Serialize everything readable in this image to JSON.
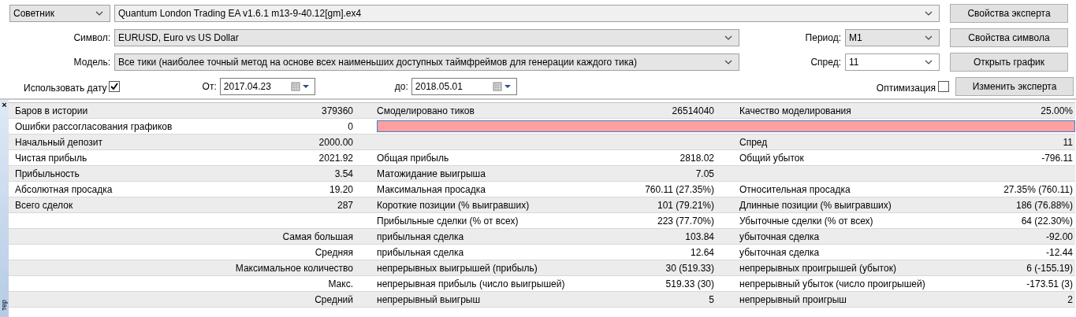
{
  "mode_select": {
    "value": "Советник"
  },
  "expert": {
    "value": "Quantum London Trading EA v1.6.1 m13-9-40.12[gm].ex4"
  },
  "symbol": {
    "label": "Символ:",
    "value": "EURUSD, Euro vs US Dollar"
  },
  "model": {
    "label": "Модель:",
    "value": "Все тики (наиболее точный метод на основе всех наименьших доступных таймфреймов для генерации каждого тика)"
  },
  "period": {
    "label": "Период:",
    "value": "M1"
  },
  "spread": {
    "label": "Спред:",
    "value": "11"
  },
  "use_date": {
    "label": "Использовать дату",
    "checked": true
  },
  "date_from": {
    "label": "От:",
    "value": "2017.04.23"
  },
  "date_to": {
    "label": "до:",
    "value": "2018.05.01"
  },
  "optimization": {
    "label": "Оптимизация",
    "checked": false
  },
  "buttons": [
    "Свойства эксперта",
    "Свойства символа",
    "Открыть график",
    "Изменить эксперта"
  ],
  "side_panel": {
    "close": "×",
    "title": "тер"
  },
  "report": {
    "rows": [
      {
        "kind": "stat",
        "cells": [
          {
            "label": "Баров в истории",
            "value": "379360"
          },
          {
            "label": "Смоделировано тиков",
            "value": "26514040"
          },
          {
            "label": "Качество моделирования",
            "value": "25.00%"
          }
        ]
      },
      {
        "kind": "bar",
        "cells": [
          {
            "label": "Ошибки рассогласования графиков",
            "value": "0"
          }
        ]
      },
      {
        "kind": "stat",
        "cells": [
          {
            "label": "Начальный депозит",
            "value": "2000.00"
          },
          {},
          {
            "label": "Спред",
            "value": "11"
          }
        ]
      },
      {
        "kind": "stat",
        "cells": [
          {
            "label": "Чистая прибыль",
            "value": "2021.92"
          },
          {
            "label": "Общая прибыль",
            "value": "2818.02"
          },
          {
            "label": "Общий убыток",
            "value": "-796.11"
          }
        ]
      },
      {
        "kind": "stat",
        "cells": [
          {
            "label": "Прибыльность",
            "value": "3.54"
          },
          {
            "label": "Матожидание выигрыша",
            "value": "7.05"
          },
          {}
        ]
      },
      {
        "kind": "stat",
        "cells": [
          {
            "label": "Абсолютная просадка",
            "value": "19.20"
          },
          {
            "label": "Максимальная просадка",
            "value": "760.11 (27.35%)"
          },
          {
            "label": "Относительная просадка",
            "value": "27.35% (760.11)"
          }
        ]
      },
      {
        "kind": "stat",
        "cells": [
          {
            "label": "Всего сделок",
            "value": "287"
          },
          {
            "label": "Короткие позиции (% выигравших)",
            "value": "101 (79.21%)"
          },
          {
            "label": "Длинные позиции (% выигравших)",
            "value": "186 (76.88%)"
          }
        ]
      },
      {
        "kind": "stat",
        "cells": [
          {},
          {
            "label": "Прибыльные сделки (% от всех)",
            "value": "223 (77.70%)"
          },
          {
            "label": "Убыточные сделки (% от всех)",
            "value": "64 (22.30%)"
          }
        ]
      },
      {
        "kind": "sub",
        "cells": [
          {
            "label": "Самая большая"
          },
          {
            "label": "прибыльная сделка",
            "value": "103.84"
          },
          {
            "label": "убыточная сделка",
            "value": "-92.00"
          }
        ]
      },
      {
        "kind": "sub",
        "cells": [
          {
            "label": "Средняя"
          },
          {
            "label": "прибыльная сделка",
            "value": "12.64"
          },
          {
            "label": "убыточная сделка",
            "value": "-12.44"
          }
        ]
      },
      {
        "kind": "sub",
        "cells": [
          {
            "label": "Максимальное количество"
          },
          {
            "label": "непрерывных выигрышей (прибыль)",
            "value": "30 (519.33)"
          },
          {
            "label": "непрерывных проигрышей (убыток)",
            "value": "6 (-155.19)"
          }
        ]
      },
      {
        "kind": "sub",
        "cells": [
          {
            "label": "Макс."
          },
          {
            "label": "непрерывная прибыль (число выигрышей)",
            "value": "519.33 (30)"
          },
          {
            "label": "непрерывный убыток (число проигрышей)",
            "value": "-173.51 (3)"
          }
        ]
      },
      {
        "kind": "sub",
        "cells": [
          {
            "label": "Средний"
          },
          {
            "label": "непрерывный выигрыш",
            "value": "5"
          },
          {
            "label": "непрерывный проигрыш",
            "value": "2"
          }
        ]
      }
    ]
  }
}
